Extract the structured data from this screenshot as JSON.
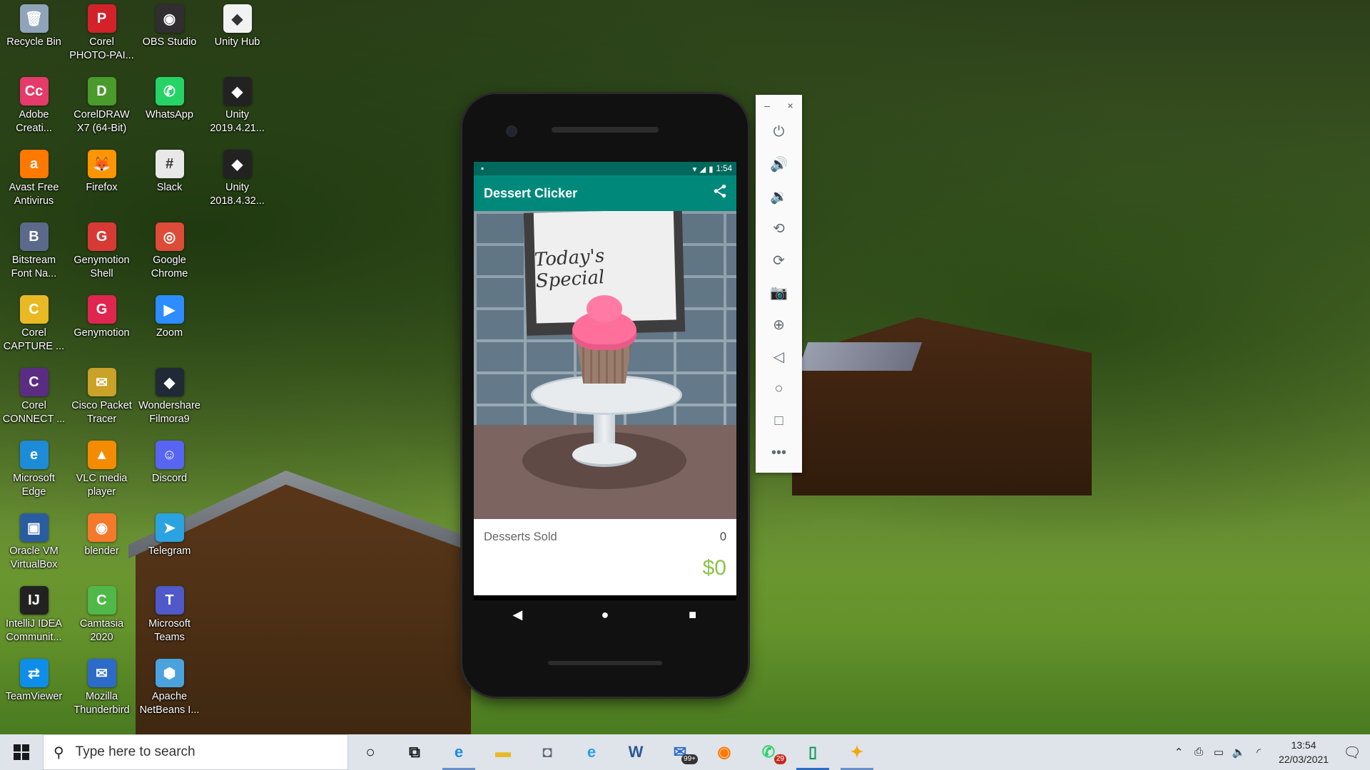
{
  "desktop": {
    "icons": [
      {
        "label": "Recycle Bin",
        "glyph": "🗑",
        "color": "#8fa4b8"
      },
      {
        "label": "Corel\nPHOTO-PAI...",
        "glyph": "P",
        "color": "#d3222a"
      },
      {
        "label": "OBS Studio",
        "glyph": "◉",
        "color": "#302e31"
      },
      {
        "label": "Unity Hub",
        "glyph": "◆",
        "color": "#f2f2f2"
      },
      {
        "label": "Adobe\nCreati...",
        "glyph": "Cc",
        "color": "#e43b6a"
      },
      {
        "label": "CorelDRAW\nX7 (64-Bit)",
        "glyph": "D",
        "color": "#4a9a2c"
      },
      {
        "label": "WhatsApp",
        "glyph": "✆",
        "color": "#25d366"
      },
      {
        "label": "Unity\n2019.4.21...",
        "glyph": "◆",
        "color": "#222222"
      },
      {
        "label": "Avast Free\nAntivirus",
        "glyph": "a",
        "color": "#ff7800"
      },
      {
        "label": "Firefox",
        "glyph": "🦊",
        "color": "#ff9500"
      },
      {
        "label": "Slack",
        "glyph": "#",
        "color": "#e8e8e8"
      },
      {
        "label": "Unity\n2018.4.32...",
        "glyph": "◆",
        "color": "#222222"
      },
      {
        "label": "Bitstream\nFont Na...",
        "glyph": "B",
        "color": "#5b6a8a"
      },
      {
        "label": "Genymotion\nShell",
        "glyph": "G",
        "color": "#d73a35"
      },
      {
        "label": "Google\nChrome",
        "glyph": "◎",
        "color": "#dd4b39"
      },
      {
        "label": "",
        "glyph": "",
        "color": ""
      },
      {
        "label": "Corel\nCAPTURE ...",
        "glyph": "C",
        "color": "#e9b923"
      },
      {
        "label": "Genymotion",
        "glyph": "G",
        "color": "#e0264f"
      },
      {
        "label": "Zoom",
        "glyph": "▶",
        "color": "#2d8cff"
      },
      {
        "label": "",
        "glyph": "",
        "color": ""
      },
      {
        "label": "Corel\nCONNECT ...",
        "glyph": "C",
        "color": "#5a2d82"
      },
      {
        "label": "Cisco Packet\nTracer",
        "glyph": "✉",
        "color": "#c9a227"
      },
      {
        "label": "Wondershare\nFilmora9",
        "glyph": "◆",
        "color": "#1f2a36"
      },
      {
        "label": "",
        "glyph": "",
        "color": ""
      },
      {
        "label": "Microsoft\nEdge",
        "glyph": "e",
        "color": "#1d8cd8"
      },
      {
        "label": "VLC media\nplayer",
        "glyph": "▲",
        "color": "#f48b00"
      },
      {
        "label": "Discord",
        "glyph": "☺",
        "color": "#5865f2"
      },
      {
        "label": "",
        "glyph": "",
        "color": ""
      },
      {
        "label": "Oracle VM\nVirtualBox",
        "glyph": "▣",
        "color": "#2a5d9f"
      },
      {
        "label": "blender",
        "glyph": "◉",
        "color": "#f5792a"
      },
      {
        "label": "Telegram",
        "glyph": "➤",
        "color": "#2aa3e0"
      },
      {
        "label": "",
        "glyph": "",
        "color": ""
      },
      {
        "label": "IntelliJ IDEA\nCommunit...",
        "glyph": "IJ",
        "color": "#222222"
      },
      {
        "label": "Camtasia\n2020",
        "glyph": "C",
        "color": "#4fb848"
      },
      {
        "label": "Microsoft\nTeams",
        "glyph": "T",
        "color": "#5059c9"
      },
      {
        "label": "",
        "glyph": "",
        "color": ""
      },
      {
        "label": "TeamViewer",
        "glyph": "⇄",
        "color": "#0e8ee9"
      },
      {
        "label": "Mozilla\nThunderbird",
        "glyph": "✉",
        "color": "#2d6bc9"
      },
      {
        "label": "Apache\nNetBeans I...",
        "glyph": "⬢",
        "color": "#4aa3df"
      },
      {
        "label": "",
        "glyph": "",
        "color": ""
      }
    ]
  },
  "phone": {
    "status": {
      "time": "1:54",
      "wifi": "▾",
      "signal": "◢",
      "battery": "▮",
      "left_icon": "▪"
    },
    "appbar": {
      "title": "Dessert Clicker",
      "share_glyph": "⋖"
    },
    "sign_text": "Today's Special",
    "info": {
      "desserts_label": "Desserts Sold",
      "desserts_count": "0",
      "revenue": "$0"
    },
    "nav": {
      "back": "◀",
      "home": "●",
      "recents": "■"
    }
  },
  "emulator_toolbar": {
    "minimize": "–",
    "close": "×",
    "tools": [
      {
        "name": "power-icon",
        "glyph": "⏻"
      },
      {
        "name": "volume-up-icon",
        "glyph": "🔊"
      },
      {
        "name": "volume-down-icon",
        "glyph": "🔉"
      },
      {
        "name": "rotate-left-icon",
        "glyph": "⟲"
      },
      {
        "name": "rotate-right-icon",
        "glyph": "⟳"
      },
      {
        "name": "camera-icon",
        "glyph": "📷"
      },
      {
        "name": "zoom-icon",
        "glyph": "⊕"
      },
      {
        "name": "back-icon",
        "glyph": "◁"
      },
      {
        "name": "home-icon",
        "glyph": "○"
      },
      {
        "name": "overview-icon",
        "glyph": "□"
      },
      {
        "name": "more-icon",
        "glyph": "•••"
      }
    ]
  },
  "taskbar": {
    "search_placeholder": "Type here to search",
    "search_glyph": "⚲",
    "apps": [
      {
        "name": "cortana-icon",
        "glyph": "○",
        "color": "#111111",
        "state": ""
      },
      {
        "name": "task-view-icon",
        "glyph": "⧉",
        "color": "#111111",
        "state": ""
      },
      {
        "name": "edge-icon",
        "glyph": "e",
        "color": "#1d8cd8",
        "state": "open"
      },
      {
        "name": "file-explorer-icon",
        "glyph": "▬",
        "color": "#e8b923",
        "state": ""
      },
      {
        "name": "camera-app-icon",
        "glyph": "◘",
        "color": "#5a6a7a",
        "state": ""
      },
      {
        "name": "internet-explorer-icon",
        "glyph": "e",
        "color": "#2d9ee0",
        "state": ""
      },
      {
        "name": "word-icon",
        "glyph": "W",
        "color": "#2b5797",
        "state": ""
      },
      {
        "name": "mail-icon",
        "glyph": "✉",
        "color": "#2d6bc9",
        "state": "",
        "badge": "99+",
        "badge_style": "dark"
      },
      {
        "name": "firefox-icon",
        "glyph": "◉",
        "color": "#ff7a00",
        "state": ""
      },
      {
        "name": "whatsapp-icon",
        "glyph": "✆",
        "color": "#25d366",
        "state": "",
        "badge": "29",
        "badge_style": "red"
      },
      {
        "name": "android-studio-icon",
        "glyph": "▯",
        "color": "#0f9d58",
        "state": "active"
      },
      {
        "name": "genymotion-icon",
        "glyph": "✦",
        "color": "#f2a900",
        "state": "open"
      }
    ],
    "tray": {
      "chevron": "⌃",
      "icons": [
        "⎙",
        "▭",
        "🔈",
        "◜"
      ],
      "time": "13:54",
      "date": "22/03/2021",
      "notification_glyph": "🗨"
    }
  }
}
